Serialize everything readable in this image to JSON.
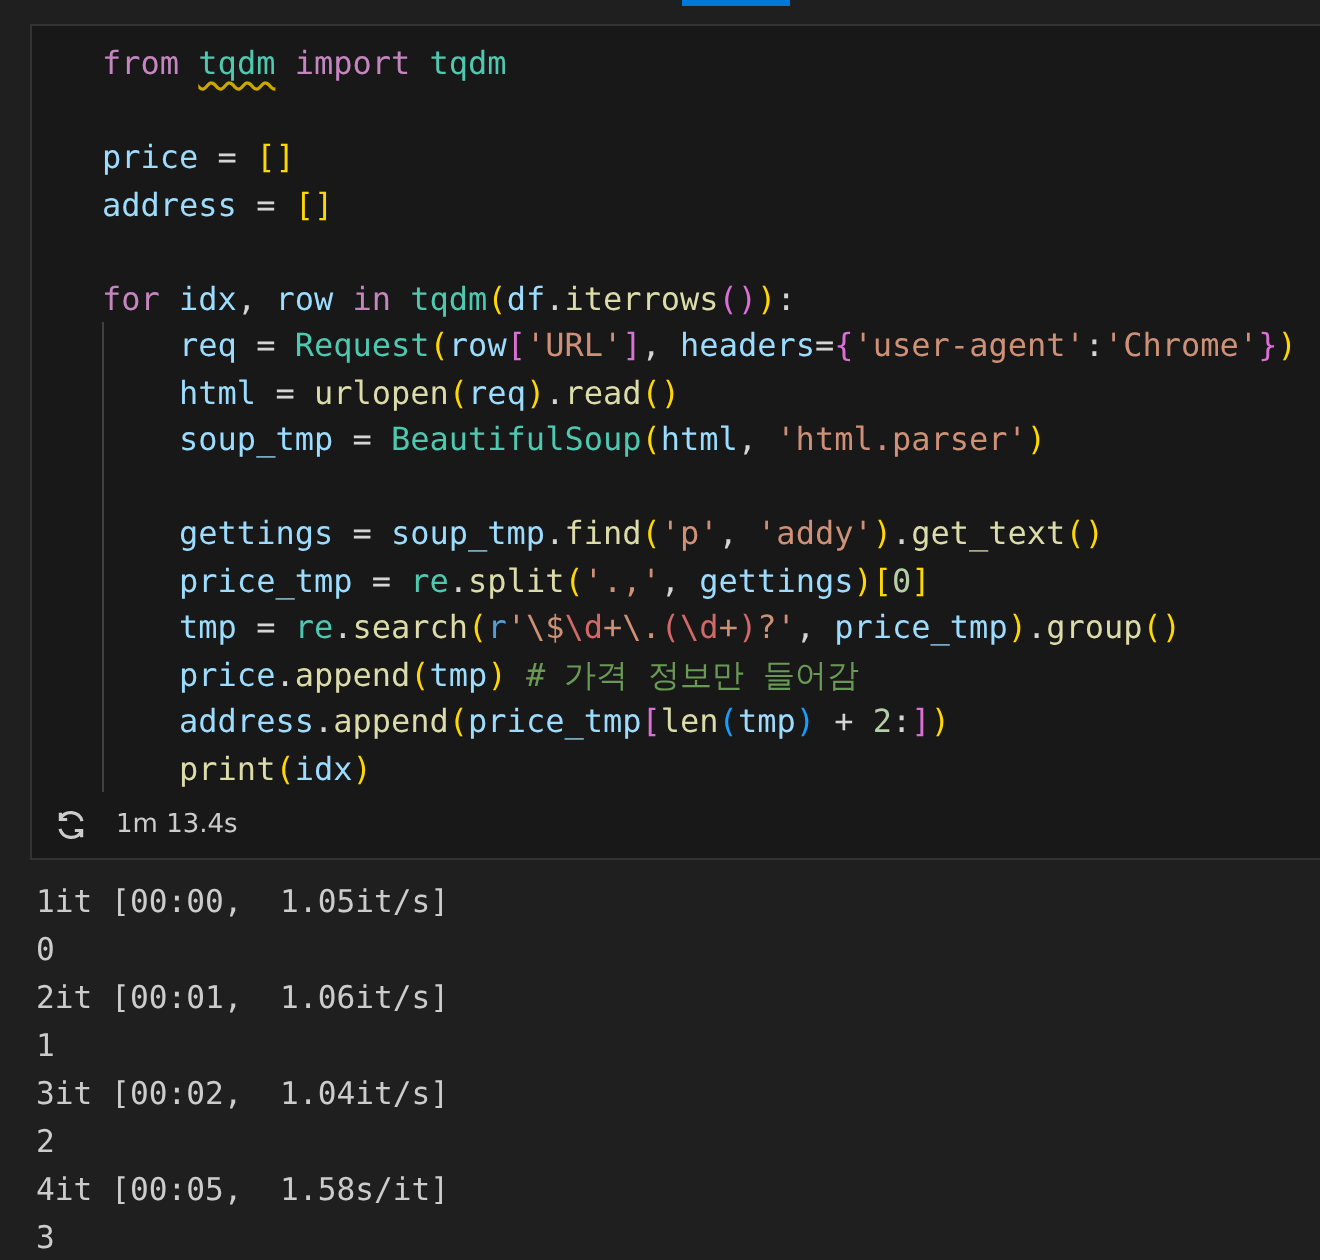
{
  "cell": {
    "code_lines": [
      {
        "kind": "code",
        "tokens": [
          {
            "t": "from ",
            "kind": "kw"
          },
          {
            "t": "tqdm",
            "kind": "cls",
            "squiggle": true
          },
          {
            "t": " import ",
            "kind": "kw"
          },
          {
            "t": "tqdm",
            "kind": "cls"
          }
        ]
      },
      {
        "kind": "blank"
      },
      {
        "kind": "code",
        "tokens": [
          {
            "t": "price",
            "kind": "var"
          },
          {
            "t": " = ",
            "kind": "op"
          },
          {
            "t": "[]",
            "kind": "b1"
          }
        ]
      },
      {
        "kind": "code",
        "tokens": [
          {
            "t": "address",
            "kind": "var"
          },
          {
            "t": " = ",
            "kind": "op"
          },
          {
            "t": "[]",
            "kind": "b1"
          }
        ]
      },
      {
        "kind": "blank"
      },
      {
        "kind": "code",
        "tokens": [
          {
            "t": "for ",
            "kind": "kw"
          },
          {
            "t": "idx",
            "kind": "var"
          },
          {
            "t": ", ",
            "kind": "op"
          },
          {
            "t": "row",
            "kind": "var"
          },
          {
            "t": " in ",
            "kind": "kw"
          },
          {
            "t": "tqdm",
            "kind": "cls"
          },
          {
            "t": "(",
            "kind": "b1"
          },
          {
            "t": "df",
            "kind": "var"
          },
          {
            "t": ".",
            "kind": "op"
          },
          {
            "t": "iterrows",
            "kind": "fn"
          },
          {
            "t": "()",
            "kind": "b2"
          },
          {
            "t": ")",
            "kind": "b1"
          },
          {
            "t": ":",
            "kind": "op"
          }
        ],
        "children": [
          {
            "kind": "code",
            "tokens": [
              {
                "t": "req",
                "kind": "var"
              },
              {
                "t": " = ",
                "kind": "op"
              },
              {
                "t": "Request",
                "kind": "cls"
              },
              {
                "t": "(",
                "kind": "b1"
              },
              {
                "t": "row",
                "kind": "var"
              },
              {
                "t": "[",
                "kind": "b2"
              },
              {
                "t": "'URL'",
                "kind": "str"
              },
              {
                "t": "]",
                "kind": "b2"
              },
              {
                "t": ", ",
                "kind": "op"
              },
              {
                "t": "headers",
                "kind": "var"
              },
              {
                "t": "=",
                "kind": "op"
              },
              {
                "t": "{",
                "kind": "b2"
              },
              {
                "t": "'user-agent'",
                "kind": "str"
              },
              {
                "t": ":",
                "kind": "op"
              },
              {
                "t": "'Chrome'",
                "kind": "str"
              },
              {
                "t": "}",
                "kind": "b2"
              },
              {
                "t": ")",
                "kind": "b1"
              }
            ]
          },
          {
            "kind": "code",
            "tokens": [
              {
                "t": "html",
                "kind": "var"
              },
              {
                "t": " = ",
                "kind": "op"
              },
              {
                "t": "urlopen",
                "kind": "fn"
              },
              {
                "t": "(",
                "kind": "b1"
              },
              {
                "t": "req",
                "kind": "var"
              },
              {
                "t": ")",
                "kind": "b1"
              },
              {
                "t": ".",
                "kind": "op"
              },
              {
                "t": "read",
                "kind": "fn"
              },
              {
                "t": "()",
                "kind": "b1"
              }
            ]
          },
          {
            "kind": "code",
            "tokens": [
              {
                "t": "soup_tmp",
                "kind": "var"
              },
              {
                "t": " = ",
                "kind": "op"
              },
              {
                "t": "BeautifulSoup",
                "kind": "cls"
              },
              {
                "t": "(",
                "kind": "b1"
              },
              {
                "t": "html",
                "kind": "var"
              },
              {
                "t": ", ",
                "kind": "op"
              },
              {
                "t": "'html.parser'",
                "kind": "str"
              },
              {
                "t": ")",
                "kind": "b1"
              }
            ]
          },
          {
            "kind": "blank"
          },
          {
            "kind": "code",
            "tokens": [
              {
                "t": "gettings",
                "kind": "var"
              },
              {
                "t": " = ",
                "kind": "op"
              },
              {
                "t": "soup_tmp",
                "kind": "var"
              },
              {
                "t": ".",
                "kind": "op"
              },
              {
                "t": "find",
                "kind": "fn"
              },
              {
                "t": "(",
                "kind": "b1"
              },
              {
                "t": "'p'",
                "kind": "str"
              },
              {
                "t": ", ",
                "kind": "op"
              },
              {
                "t": "'addy'",
                "kind": "str"
              },
              {
                "t": ")",
                "kind": "b1"
              },
              {
                "t": ".",
                "kind": "op"
              },
              {
                "t": "get_text",
                "kind": "fn"
              },
              {
                "t": "()",
                "kind": "b1"
              }
            ]
          },
          {
            "kind": "code",
            "tokens": [
              {
                "t": "price_tmp",
                "kind": "var"
              },
              {
                "t": " = ",
                "kind": "op"
              },
              {
                "t": "re",
                "kind": "cls"
              },
              {
                "t": ".",
                "kind": "op"
              },
              {
                "t": "split",
                "kind": "fn"
              },
              {
                "t": "(",
                "kind": "b1"
              },
              {
                "t": "'.,'",
                "kind": "str"
              },
              {
                "t": ", ",
                "kind": "op"
              },
              {
                "t": "gettings",
                "kind": "var"
              },
              {
                "t": ")",
                "kind": "b1"
              },
              {
                "t": "[",
                "kind": "b1"
              },
              {
                "t": "0",
                "kind": "num"
              },
              {
                "t": "]",
                "kind": "b1"
              }
            ]
          },
          {
            "kind": "code",
            "tokens": [
              {
                "t": "tmp",
                "kind": "var"
              },
              {
                "t": " = ",
                "kind": "op"
              },
              {
                "t": "re",
                "kind": "cls"
              },
              {
                "t": ".",
                "kind": "op"
              },
              {
                "t": "search",
                "kind": "fn"
              },
              {
                "t": "(",
                "kind": "b1"
              },
              {
                "t": "r",
                "kind": "prefix"
              },
              {
                "t": "'\\$",
                "kind": "str"
              },
              {
                "t": "\\d",
                "kind": "rx"
              },
              {
                "t": "+\\.",
                "kind": "str"
              },
              {
                "t": "(",
                "kind": "rx"
              },
              {
                "t": "\\d",
                "kind": "rx"
              },
              {
                "t": "+",
                "kind": "str"
              },
              {
                "t": ")",
                "kind": "rx"
              },
              {
                "t": "?'",
                "kind": "str"
              },
              {
                "t": ", ",
                "kind": "op"
              },
              {
                "t": "price_tmp",
                "kind": "var"
              },
              {
                "t": ")",
                "kind": "b1"
              },
              {
                "t": ".",
                "kind": "op"
              },
              {
                "t": "group",
                "kind": "fn"
              },
              {
                "t": "()",
                "kind": "b1"
              }
            ]
          },
          {
            "kind": "code",
            "tokens": [
              {
                "t": "price",
                "kind": "var"
              },
              {
                "t": ".",
                "kind": "op"
              },
              {
                "t": "append",
                "kind": "fn"
              },
              {
                "t": "(",
                "kind": "b1"
              },
              {
                "t": "tmp",
                "kind": "var"
              },
              {
                "t": ")",
                "kind": "b1"
              },
              {
                "t": " # 가격 정보만 들어감",
                "kind": "cmt"
              }
            ]
          },
          {
            "kind": "code",
            "tokens": [
              {
                "t": "address",
                "kind": "var"
              },
              {
                "t": ".",
                "kind": "op"
              },
              {
                "t": "append",
                "kind": "fn"
              },
              {
                "t": "(",
                "kind": "b1"
              },
              {
                "t": "price_tmp",
                "kind": "var"
              },
              {
                "t": "[",
                "kind": "b2"
              },
              {
                "t": "len",
                "kind": "fn"
              },
              {
                "t": "(",
                "kind": "b3"
              },
              {
                "t": "tmp",
                "kind": "var"
              },
              {
                "t": ")",
                "kind": "b3"
              },
              {
                "t": " + ",
                "kind": "op"
              },
              {
                "t": "2",
                "kind": "num"
              },
              {
                "t": ":",
                "kind": "op"
              },
              {
                "t": "]",
                "kind": "b2"
              },
              {
                "t": ")",
                "kind": "b1"
              }
            ]
          },
          {
            "kind": "code",
            "tokens": [
              {
                "t": "print",
                "kind": "fn"
              },
              {
                "t": "(",
                "kind": "b1"
              },
              {
                "t": "idx",
                "kind": "var"
              },
              {
                "t": ")",
                "kind": "b1"
              }
            ]
          }
        ]
      }
    ],
    "duration": "1m 13.4s"
  },
  "output": [
    "1it [00:00,  1.05it/s]",
    "0",
    "2it [00:01,  1.06it/s]",
    "1",
    "3it [00:02,  1.04it/s]",
    "2",
    "4it [00:05,  1.58s/it]",
    "3"
  ]
}
